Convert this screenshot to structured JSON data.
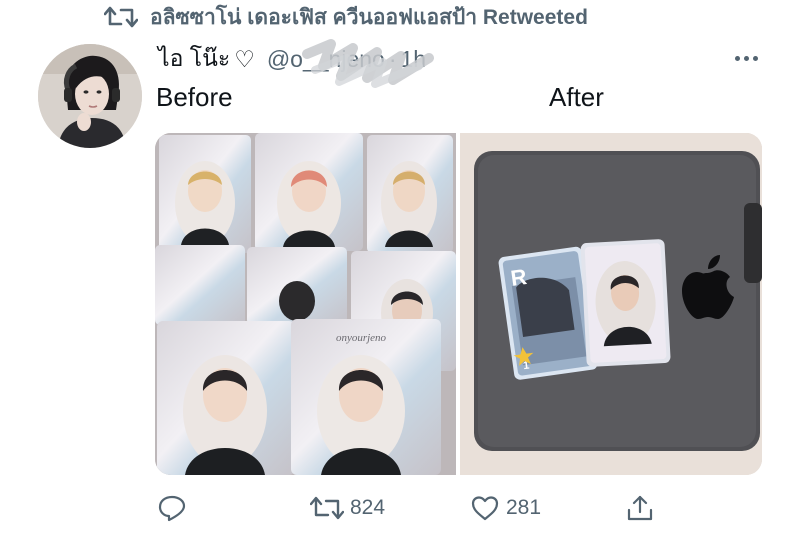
{
  "retweet_context": {
    "text": "อลิซซาโน่ เดอะเฟิส ควีนออฟแอสป้า Retweeted",
    "icon": "retweet-icon"
  },
  "tweet": {
    "author_name": "ไอ โน๊ะ",
    "author_heart": "♡",
    "handle": "@o__njeno",
    "separator": "·",
    "time": "1h",
    "more_icon": "more-horizontal-icon",
    "captions": {
      "before": "Before",
      "after": "After"
    },
    "media": [
      {
        "label": "before-photo",
        "description_icon": "photocards-collage"
      },
      {
        "label": "after-photo",
        "description_icon": "laptop-with-cards"
      }
    ],
    "card_signature": "onyourjeno",
    "card_number": "1",
    "card_letter": "R"
  },
  "actions": {
    "reply": {
      "icon": "reply-icon",
      "count": ""
    },
    "retweet": {
      "icon": "retweet-icon",
      "count": "824"
    },
    "like": {
      "icon": "heart-icon",
      "count": "281"
    },
    "share": {
      "icon": "share-icon",
      "count": ""
    }
  },
  "colors": {
    "secondary_text": "#536471",
    "primary_text": "#0f1419"
  }
}
